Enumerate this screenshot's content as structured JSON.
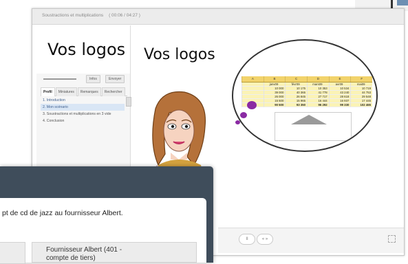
{
  "window": {
    "title": "Soustractions et multiplications",
    "time": "( 00:06 / 04:27 )"
  },
  "sidebar": {
    "logo_text": "Vos logos",
    "buttons": {
      "info": "Infos",
      "envoyer": "Envoyer"
    },
    "tabs": [
      "Profil",
      "Miniatures",
      "Remarques",
      "Rechercher"
    ],
    "outline": [
      "1. Introduction",
      "2. Mon scénario",
      "3. Soustractions et multiplications en 3 vide",
      "4. Conclusion"
    ],
    "active_index": 1
  },
  "slide": {
    "title": "Vos logos",
    "spreadsheet": {
      "columns": [
        "A",
        "B",
        "C",
        "D",
        "E",
        "F"
      ],
      "months": [
        "",
        "janv09",
        "févr09",
        "mars09",
        "avr09",
        "mai09"
      ],
      "rows": [
        [
          "",
          "10 000",
          "10 175",
          "10 353",
          "10 534",
          "10 719"
        ],
        [
          "",
          "39 000",
          "40 365",
          "41 778",
          "43 240",
          "44 753"
        ],
        [
          "",
          "26 000",
          "26 845",
          "27 717",
          "28 618",
          "29 548"
        ],
        [
          "",
          "15 500",
          "15 965",
          "16 444",
          "16 937",
          "17 445"
        ]
      ],
      "total": [
        "",
        "90 500",
        "93 350",
        "96 292",
        "99 330",
        "102 465"
      ]
    }
  },
  "player": {
    "play_label": "II",
    "nav_label": "« »"
  },
  "dialog": {
    "prompt": "pt de cd de jazz au fournisseur Albert.",
    "choice_right": "Fournisseur Albert (401 -\ncompte de tiers)"
  }
}
